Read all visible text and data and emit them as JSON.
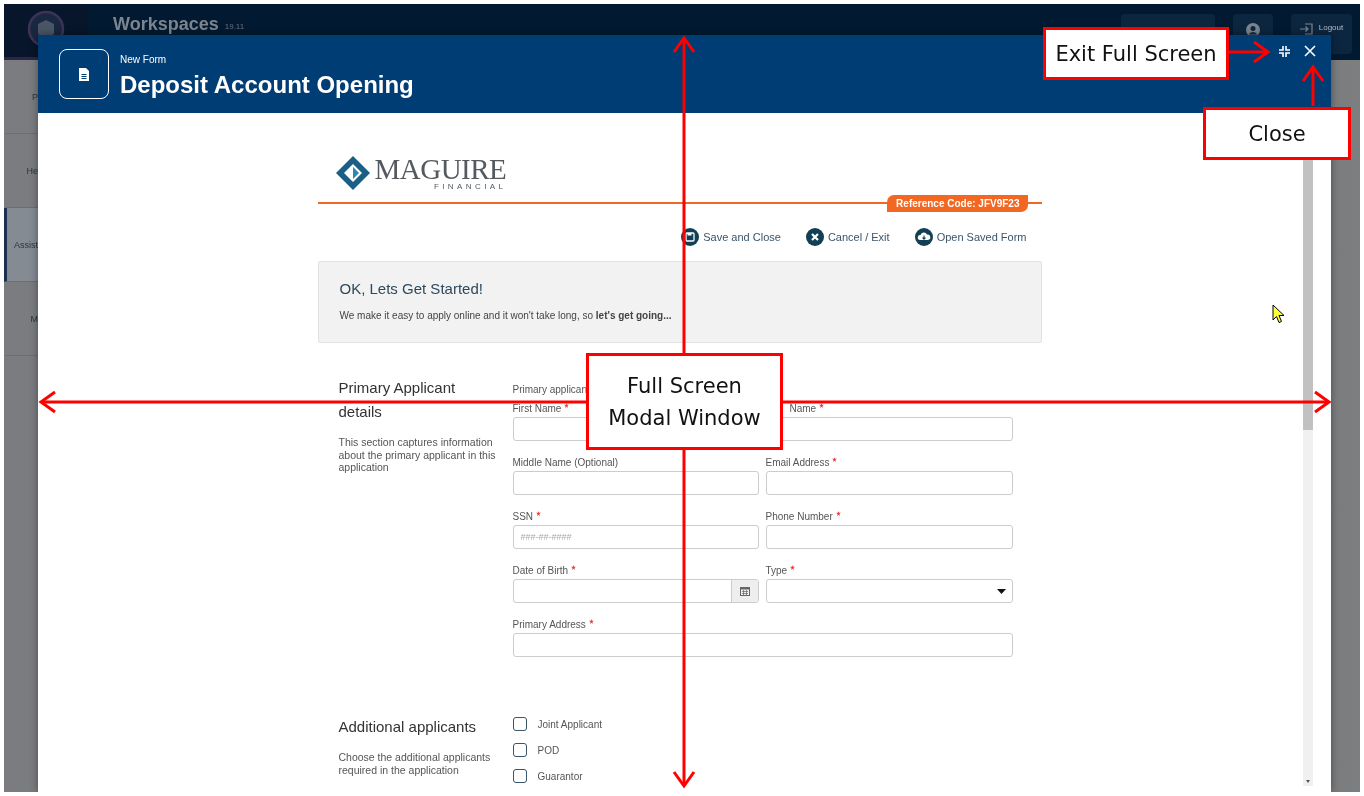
{
  "background_app": {
    "title": "Workspaces",
    "version": "19.11",
    "logout": "Logout",
    "nav_items": [
      {
        "label": "P",
        "selected": false
      },
      {
        "label": "He",
        "selected": false
      },
      {
        "label": "Assist",
        "selected": true
      },
      {
        "label": "M",
        "selected": false
      }
    ]
  },
  "modal": {
    "subtitle": "New Form",
    "title": "Deposit Account Opening"
  },
  "form": {
    "brand": {
      "name": "MAGUIRE",
      "tagline": "FINANCIAL"
    },
    "reference": "Reference Code: JFV9F23",
    "actions": [
      {
        "kind": "save",
        "label": "Save and Close"
      },
      {
        "kind": "cancel",
        "label": "Cancel / Exit"
      },
      {
        "kind": "open",
        "label": "Open Saved Form"
      }
    ],
    "intro": {
      "heading": "OK, Lets Get Started!",
      "text": "We make it easy to apply online and it won't take long, so **let's get going...**"
    },
    "sections": [
      {
        "title": "Primary Applicant details",
        "description": "This section captures information about the primary applicant in this application",
        "note": "Primary applican",
        "fields": [
          {
            "kind": "text",
            "label": "First Name",
            "required": true
          },
          {
            "kind": "text",
            "label": "Name",
            "required": true
          },
          {
            "kind": "text",
            "label": "Middle Name (Optional)",
            "required": false
          },
          {
            "kind": "text",
            "label": "Email Address",
            "required": true
          },
          {
            "kind": "text",
            "label": "SSN",
            "required": true,
            "placeholder": "###-##-####"
          },
          {
            "kind": "text",
            "label": "Phone Number",
            "required": true
          },
          {
            "kind": "date",
            "label": "Date of Birth",
            "required": true
          },
          {
            "kind": "select",
            "label": "Type",
            "required": true
          },
          {
            "kind": "wide",
            "label": "Primary Address",
            "required": true
          }
        ]
      },
      {
        "title": "Additional applicants",
        "description": "Choose the additional applicants required in the application",
        "options": [
          {
            "label": "Joint Applicant",
            "checked": false
          },
          {
            "label": "POD",
            "checked": false
          },
          {
            "label": "Guarantor",
            "checked": false
          }
        ]
      }
    ]
  },
  "annotations": [
    {
      "kind": "exit",
      "text": "Exit Full Screen"
    },
    {
      "kind": "close",
      "text": "Close"
    },
    {
      "kind": "center",
      "text": "Full Screen Modal Window"
    }
  ]
}
